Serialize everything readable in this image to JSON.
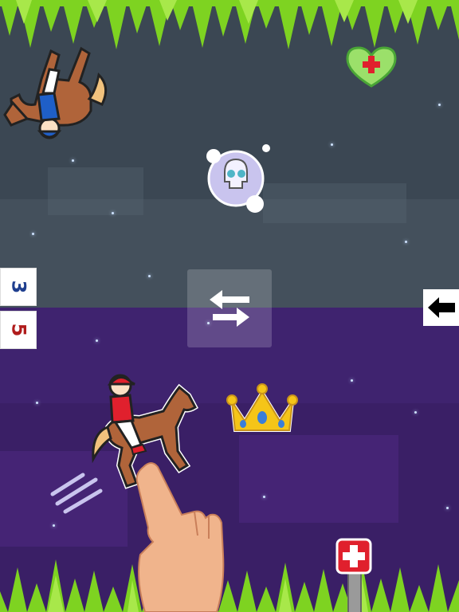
{
  "scores": {
    "player_top": "3",
    "player_bottom": "5"
  },
  "colors": {
    "top_background": "#3b4753",
    "bottom_background": "#3a1f66",
    "score_top": "#1f3f8f",
    "score_bottom": "#b01c1c",
    "grass": "#7ed321",
    "health_red": "#e0202d"
  },
  "icons": {
    "top_jockey": "horse-racing-jockey-blue",
    "bottom_jockey": "horse-racing-jockey-red",
    "skull_cloud": "skull-cloud",
    "crown": "crown",
    "green_heart_health": "heart-plus",
    "health_sign": "health-plus-sign",
    "swap": "swap-arrows",
    "exit": "arrow-left",
    "hand": "pointing-hand"
  }
}
